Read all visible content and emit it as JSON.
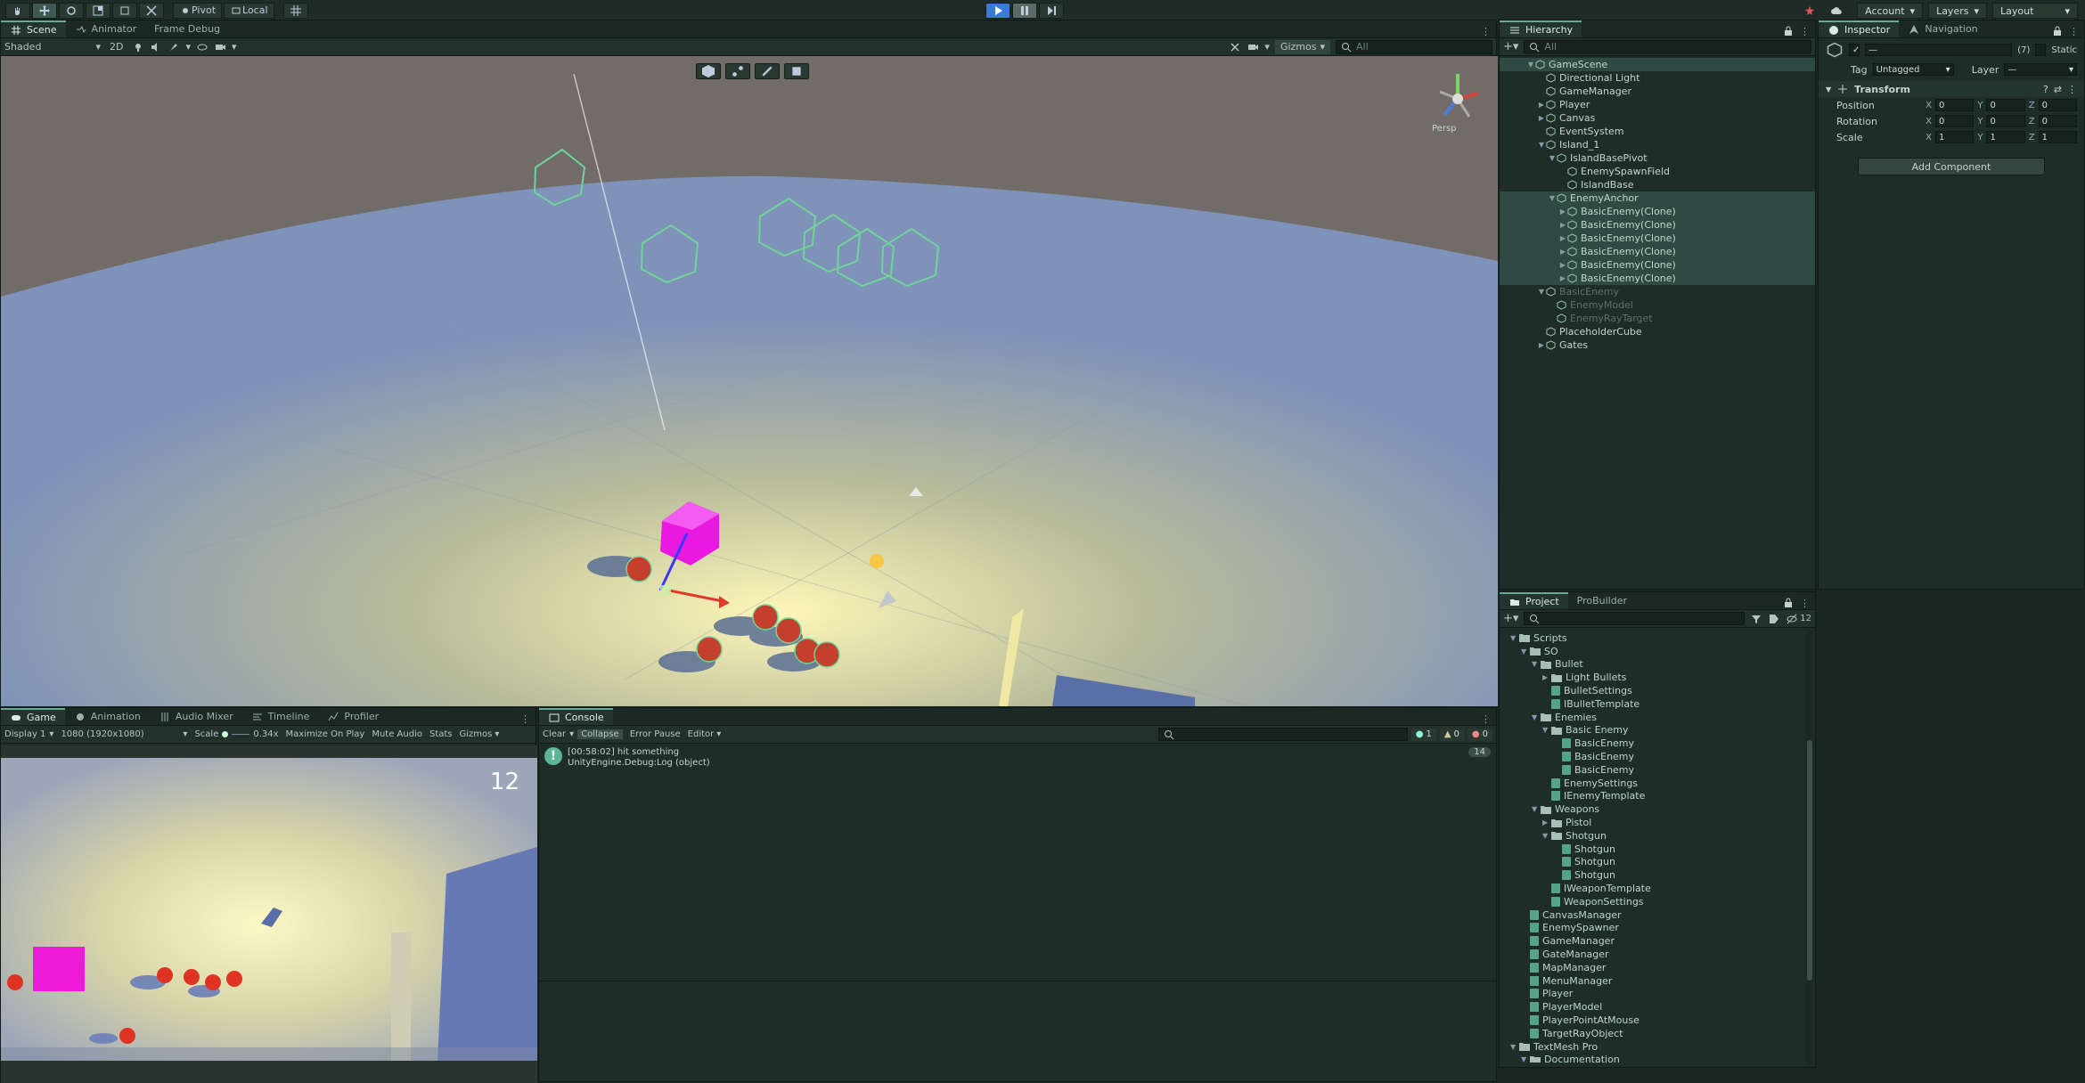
{
  "toolbar": {
    "pivot_label": "Pivot",
    "local_label": "Local",
    "account_label": "Account",
    "layers_label": "Layers",
    "layout_label": "Layout"
  },
  "scene": {
    "tabs": [
      "Scene",
      "Animator",
      "Frame Debug"
    ],
    "shading_mode": "Shaded",
    "mode_2d": "2D",
    "gizmos_label": "Gizmos",
    "search_placeholder": "All",
    "persp_label": "Persp"
  },
  "hierarchy": {
    "tab_label": "Hierarchy",
    "search_placeholder": "All",
    "items": [
      {
        "label": "GameScene",
        "depth": 0,
        "arrow": "▼",
        "sel": true
      },
      {
        "label": "Directional Light",
        "depth": 1,
        "arrow": ""
      },
      {
        "label": "GameManager",
        "depth": 1,
        "arrow": ""
      },
      {
        "label": "Player",
        "depth": 1,
        "arrow": "▶"
      },
      {
        "label": "Canvas",
        "depth": 1,
        "arrow": "▶"
      },
      {
        "label": "EventSystem",
        "depth": 1,
        "arrow": ""
      },
      {
        "label": "Island_1",
        "depth": 1,
        "arrow": "▼"
      },
      {
        "label": "IslandBasePivot",
        "depth": 2,
        "arrow": "▼"
      },
      {
        "label": "EnemySpawnField",
        "depth": 3,
        "arrow": ""
      },
      {
        "label": "IslandBase",
        "depth": 3,
        "arrow": ""
      },
      {
        "label": "EnemyAnchor",
        "depth": 2,
        "arrow": "▼",
        "sel": true
      },
      {
        "label": "BasicEnemy(Clone)",
        "depth": 3,
        "arrow": "▶",
        "sel": true
      },
      {
        "label": "BasicEnemy(Clone)",
        "depth": 3,
        "arrow": "▶",
        "sel": true
      },
      {
        "label": "BasicEnemy(Clone)",
        "depth": 3,
        "arrow": "▶",
        "sel": true
      },
      {
        "label": "BasicEnemy(Clone)",
        "depth": 3,
        "arrow": "▶",
        "sel": true
      },
      {
        "label": "BasicEnemy(Clone)",
        "depth": 3,
        "arrow": "▶",
        "sel": true
      },
      {
        "label": "BasicEnemy(Clone)",
        "depth": 3,
        "arrow": "▶",
        "sel": true
      },
      {
        "label": "BasicEnemy",
        "depth": 1,
        "arrow": "▼",
        "dim": true
      },
      {
        "label": "EnemyModel",
        "depth": 2,
        "arrow": "",
        "dim": true
      },
      {
        "label": "EnemyRayTarget",
        "depth": 2,
        "arrow": "",
        "dim": true
      },
      {
        "label": "PlaceholderCube",
        "depth": 1,
        "arrow": ""
      },
      {
        "label": "Gates",
        "depth": 1,
        "arrow": "▶"
      }
    ]
  },
  "inspector": {
    "tabs": [
      "Inspector",
      "Navigation"
    ],
    "tag_label": "Tag",
    "tag_value": "Untagged",
    "layer_label": "Layer",
    "layer_value": "—",
    "static_label": "Static",
    "count_label": "(7)",
    "transform_label": "Transform",
    "position": {
      "label": "Position",
      "x": "0",
      "y": "0",
      "z": "0"
    },
    "rotation": {
      "label": "Rotation",
      "x": "0",
      "y": "0",
      "z": "0"
    },
    "scale": {
      "label": "Scale",
      "x": "1",
      "y": "1",
      "z": "1"
    },
    "add_component": "Add Component"
  },
  "project": {
    "tabs": [
      "Project",
      "ProBuilder"
    ],
    "count": "12",
    "items": [
      {
        "label": "Scripts",
        "depth": 0,
        "type": "folder",
        "arrow": "▼"
      },
      {
        "label": "SO",
        "depth": 1,
        "type": "folder",
        "arrow": "▼"
      },
      {
        "label": "Bullet",
        "depth": 2,
        "type": "folder",
        "arrow": "▼"
      },
      {
        "label": "Light Bullets",
        "depth": 3,
        "type": "folder",
        "arrow": "▶"
      },
      {
        "label": "BulletSettings",
        "depth": 3,
        "type": "script",
        "arrow": ""
      },
      {
        "label": "IBulletTemplate",
        "depth": 3,
        "type": "script",
        "arrow": ""
      },
      {
        "label": "Enemies",
        "depth": 2,
        "type": "folder",
        "arrow": "▼"
      },
      {
        "label": "Basic Enemy",
        "depth": 3,
        "type": "folder",
        "arrow": "▼"
      },
      {
        "label": "BasicEnemy",
        "depth": 4,
        "type": "script",
        "arrow": ""
      },
      {
        "label": "BasicEnemy",
        "depth": 4,
        "type": "script",
        "arrow": ""
      },
      {
        "label": "BasicEnemy",
        "depth": 4,
        "type": "script",
        "arrow": ""
      },
      {
        "label": "EnemySettings",
        "depth": 3,
        "type": "script",
        "arrow": ""
      },
      {
        "label": "IEnemyTemplate",
        "depth": 3,
        "type": "script",
        "arrow": ""
      },
      {
        "label": "Weapons",
        "depth": 2,
        "type": "folder",
        "arrow": "▼"
      },
      {
        "label": "Pistol",
        "depth": 3,
        "type": "folder",
        "arrow": "▶"
      },
      {
        "label": "Shotgun",
        "depth": 3,
        "type": "folder",
        "arrow": "▼"
      },
      {
        "label": "Shotgun",
        "depth": 4,
        "type": "script",
        "arrow": ""
      },
      {
        "label": "Shotgun",
        "depth": 4,
        "type": "script",
        "arrow": ""
      },
      {
        "label": "Shotgun",
        "depth": 4,
        "type": "script",
        "arrow": ""
      },
      {
        "label": "IWeaponTemplate",
        "depth": 3,
        "type": "script",
        "arrow": ""
      },
      {
        "label": "WeaponSettings",
        "depth": 3,
        "type": "script",
        "arrow": ""
      },
      {
        "label": "CanvasManager",
        "depth": 1,
        "type": "script",
        "arrow": ""
      },
      {
        "label": "EnemySpawner",
        "depth": 1,
        "type": "script",
        "arrow": ""
      },
      {
        "label": "GameManager",
        "depth": 1,
        "type": "script",
        "arrow": ""
      },
      {
        "label": "GateManager",
        "depth": 1,
        "type": "script",
        "arrow": ""
      },
      {
        "label": "MapManager",
        "depth": 1,
        "type": "script",
        "arrow": ""
      },
      {
        "label": "MenuManager",
        "depth": 1,
        "type": "script",
        "arrow": ""
      },
      {
        "label": "Player",
        "depth": 1,
        "type": "script",
        "arrow": ""
      },
      {
        "label": "PlayerModel",
        "depth": 1,
        "type": "script",
        "arrow": ""
      },
      {
        "label": "PlayerPointAtMouse",
        "depth": 1,
        "type": "script",
        "arrow": ""
      },
      {
        "label": "TargetRayObject",
        "depth": 1,
        "type": "script",
        "arrow": ""
      },
      {
        "label": "TextMesh Pro",
        "depth": 0,
        "type": "folder",
        "arrow": "▼"
      },
      {
        "label": "Documentation",
        "depth": 1,
        "type": "folder",
        "arrow": "▼"
      }
    ]
  },
  "game": {
    "tabs": [
      "Game",
      "Animation",
      "Audio Mixer",
      "Timeline",
      "Profiler"
    ],
    "display": "Display 1",
    "resolution": "1080 (1920x1080)",
    "scale_label": "Scale",
    "scale_value": "0.34x",
    "maximize": "Maximize On Play",
    "mute": "Mute Audio",
    "stats": "Stats",
    "gizmos": "Gizmos",
    "counter": "12"
  },
  "console": {
    "tab_label": "Console",
    "clear": "Clear",
    "collapse": "Collapse",
    "error_pause": "Error Pause",
    "editor": "Editor",
    "count_info": "1",
    "count_warn": "0",
    "count_error": "0",
    "log_line1": "[00:58:02] hit something",
    "log_line2": "UnityEngine.Debug:Log (object)",
    "log_count": "14"
  }
}
